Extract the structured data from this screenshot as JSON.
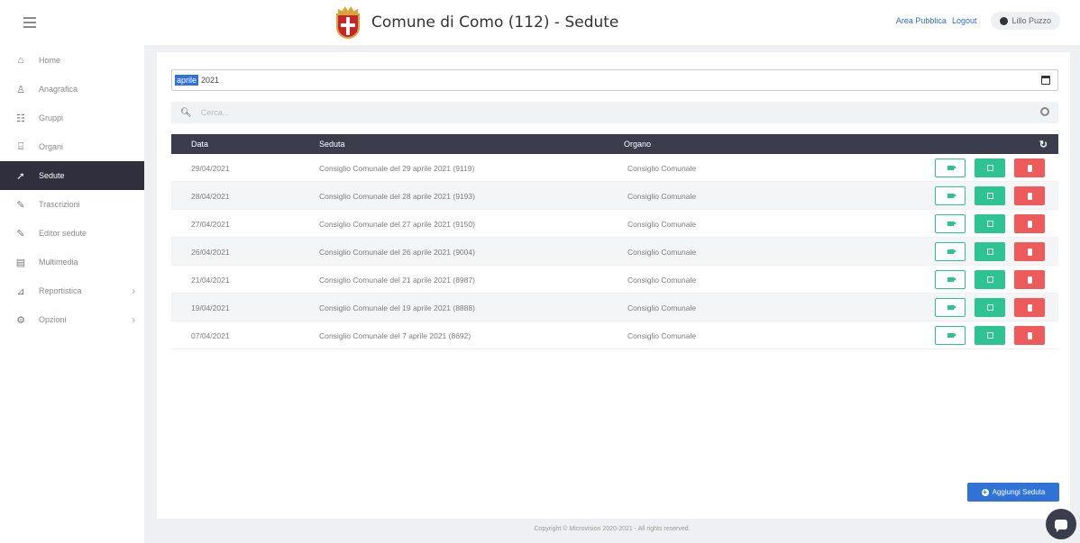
{
  "header": {
    "title": "Comune di Como (112) - Sedute",
    "links": [
      "Area Pubblica",
      "Logout"
    ],
    "user": "Lillo Puzzo"
  },
  "sidebar": {
    "items": [
      {
        "label": "Home",
        "icon": "dashboard-icon"
      },
      {
        "label": "Anagrafica",
        "icon": "user-icon"
      },
      {
        "label": "Gruppi",
        "icon": "group-icon"
      },
      {
        "label": "Organi",
        "icon": "institution-icon"
      },
      {
        "label": "Sedute",
        "icon": "gavel-icon",
        "active": true
      },
      {
        "label": "Trascrizioni",
        "icon": "edit-icon"
      },
      {
        "label": "Editor sedute",
        "icon": "edit-icon"
      },
      {
        "label": "Multimedia",
        "icon": "film-icon"
      },
      {
        "label": "Reportistica",
        "icon": "chart-icon",
        "chevron": "›"
      },
      {
        "label": "Opzioni",
        "icon": "cogs-icon",
        "chevron": "›"
      }
    ]
  },
  "filters": {
    "month": "aprile",
    "year": "2021",
    "search_placeholder": "Cerca..."
  },
  "table": {
    "headers": {
      "date": "Data",
      "seduta": "Seduta",
      "organo": "Organo"
    },
    "rows": [
      {
        "date": "29/04/2021",
        "seduta": "Consiglio Comunale del 29 aprile 2021 (9119)",
        "organo": "Consiglio Comunale"
      },
      {
        "date": "28/04/2021",
        "seduta": "Consiglio Comunale del 28 aprile 2021 (9193)",
        "organo": "Consiglio Comunale"
      },
      {
        "date": "27/04/2021",
        "seduta": "Consiglio Comunale del 27 aprile 2021 (9150)",
        "organo": "Consiglio Comunale"
      },
      {
        "date": "26/04/2021",
        "seduta": "Consiglio Comunale del 26 aprile 2021 (9004)",
        "organo": "Consiglio Comunale"
      },
      {
        "date": "21/04/2021",
        "seduta": "Consiglio Comunale del 21 aprile 2021 (8987)",
        "organo": "Consiglio Comunale"
      },
      {
        "date": "19/04/2021",
        "seduta": "Consiglio Comunale del 19 aprile 2021 (8888)",
        "organo": "Consiglio Comunale"
      },
      {
        "date": "07/04/2021",
        "seduta": "Consiglio Comunale del 7 aprile 2021 (8692)",
        "organo": "Consiglio Comunale"
      }
    ]
  },
  "add_button": "Aggiungi Seduta",
  "footer": "Copyright © Microvision 2020-2021 - All rights reserved.",
  "colors": {
    "sidebar_active": "#2f2f3e",
    "table_header": "#3b3d4c",
    "accent_blue": "#2f73d8",
    "green": "#2ec492",
    "red": "#ef5a5a"
  }
}
